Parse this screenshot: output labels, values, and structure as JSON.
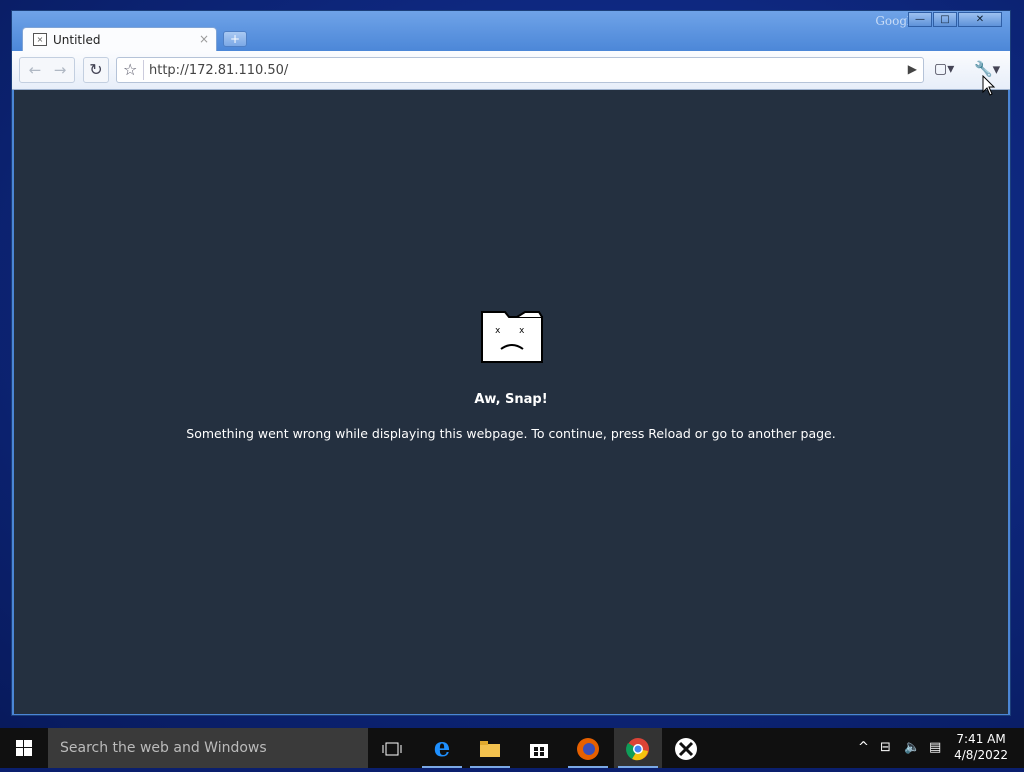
{
  "browser": {
    "brand_label": "Google",
    "tab": {
      "title": "Untitled",
      "close_glyph": "×"
    },
    "newtab_glyph": "+",
    "nav": {
      "back_glyph": "←",
      "forward_glyph": "→",
      "reload_glyph": "↻"
    },
    "omnibox": {
      "url": "http://172.81.110.50/",
      "star_glyph": "☆",
      "go_glyph": "▶"
    },
    "menus": {
      "page_glyph": "▢▾",
      "wrench_glyph": "🔧▾"
    },
    "window_controls": {
      "minimize": "—",
      "maximize": "□",
      "close": "✕"
    }
  },
  "error_page": {
    "title": "Aw, Snap!",
    "message": "Something went wrong while displaying this webpage. To continue, press Reload or go to another page."
  },
  "taskbar": {
    "search_placeholder": "Search the web and Windows",
    "icons": [
      "windows-start-icon",
      "task-view-icon",
      "edge-icon",
      "file-explorer-icon",
      "store-icon",
      "firefox-icon",
      "chrome-icon",
      "xbox-icon"
    ],
    "clock_time": "7:41 AM",
    "clock_date": "4/8/2022"
  }
}
